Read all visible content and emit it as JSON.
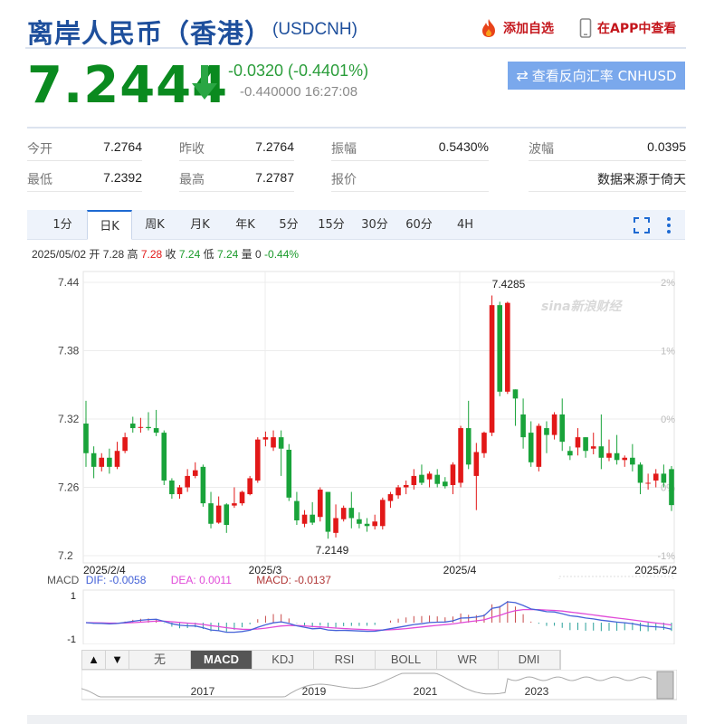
{
  "header": {
    "title": "离岸人民币（香港）",
    "code": "(USDCNH)",
    "add_watch": "添加自选",
    "app_view": "在APP中查看"
  },
  "quote": {
    "price": "7.2444",
    "change": "-0.0320 (-0.4401%)",
    "sub": "-0.440000 16:27:08",
    "reverse_btn": "查看反向汇率 CNHUSD",
    "direction": "down"
  },
  "stats": {
    "open_label": "今开",
    "open": "7.2764",
    "prev_label": "昨收",
    "prev": "7.2764",
    "amp_label": "振幅",
    "amp": "0.5430%",
    "wave_label": "波幅",
    "wave": "0.0395",
    "low_label": "最低",
    "low": "7.2392",
    "high_label": "最高",
    "high": "7.2787",
    "bid_label": "报价",
    "source": "数据来源于倚天"
  },
  "tabs": [
    "1分",
    "日K",
    "周K",
    "月K",
    "年K",
    "5分",
    "15分",
    "30分",
    "60分",
    "4H"
  ],
  "active_tab": "日K",
  "ohlc": {
    "date": "2025/05/02",
    "open_l": "开",
    "open": "7.28",
    "high_l": "高",
    "high": "7.28",
    "close_l": "收",
    "close": "7.24",
    "low_l": "低",
    "low": "7.24",
    "vol_l": "量",
    "vol": "0",
    "pct": "-0.44%"
  },
  "chart_data": [
    {
      "type": "candlestick",
      "y_ticks": [
        "7.44",
        "7.38",
        "7.32",
        "7.26",
        "7.2"
      ],
      "pct_ticks": [
        "2%",
        "1%",
        "0%",
        "0%",
        "-1%"
      ],
      "ylim": [
        7.2,
        7.44
      ],
      "x_labels": [
        "2025/2/4",
        "2025/3",
        "2025/4",
        "2025/5/2"
      ],
      "max_label": "7.4285",
      "min_label": "7.2149",
      "watermark": "sina新浪财经",
      "candles": [
        [
          7.316,
          7.29,
          7.336,
          7.278
        ],
        [
          7.29,
          7.278,
          7.296,
          7.268
        ],
        [
          7.278,
          7.286,
          7.29,
          7.274
        ],
        [
          7.286,
          7.278,
          7.294,
          7.272
        ],
        [
          7.278,
          7.292,
          7.3,
          7.276
        ],
        [
          7.292,
          7.304,
          7.308,
          7.29
        ],
        [
          7.316,
          7.312,
          7.322,
          7.308
        ],
        [
          7.313,
          7.313,
          7.321,
          7.308
        ],
        [
          7.313,
          7.312,
          7.326,
          7.31
        ],
        [
          7.312,
          7.308,
          7.328,
          7.305
        ],
        [
          7.308,
          7.266,
          7.31,
          7.262
        ],
        [
          7.266,
          7.254,
          7.268,
          7.25
        ],
        [
          7.254,
          7.26,
          7.262,
          7.25
        ],
        [
          7.26,
          7.27,
          7.276,
          7.256
        ],
        [
          7.27,
          7.275,
          7.282,
          7.268
        ],
        [
          7.278,
          7.246,
          7.28,
          7.243
        ],
        [
          7.246,
          7.228,
          7.256,
          7.224
        ],
        [
          7.229,
          7.244,
          7.252,
          7.228
        ],
        [
          7.245,
          7.227,
          7.246,
          7.22
        ],
        [
          7.244,
          7.246,
          7.26,
          7.242
        ],
        [
          7.246,
          7.256,
          7.257,
          7.244
        ],
        [
          7.254,
          7.268,
          7.27,
          7.253
        ],
        [
          7.266,
          7.302,
          7.304,
          7.264
        ],
        [
          7.302,
          7.304,
          7.309,
          7.296
        ],
        [
          7.295,
          7.304,
          7.31,
          7.292
        ],
        [
          7.304,
          7.294,
          7.31,
          7.27
        ],
        [
          7.293,
          7.251,
          7.298,
          7.248
        ],
        [
          7.248,
          7.231,
          7.256,
          7.227
        ],
        [
          7.228,
          7.236,
          7.24,
          7.225
        ],
        [
          7.236,
          7.229,
          7.247,
          7.227
        ],
        [
          7.234,
          7.258,
          7.26,
          7.23
        ],
        [
          7.256,
          7.221,
          7.256,
          7.2149
        ],
        [
          7.22,
          7.233,
          7.245,
          7.216
        ],
        [
          7.232,
          7.242,
          7.244,
          7.23
        ],
        [
          7.242,
          7.233,
          7.256,
          7.224
        ],
        [
          7.232,
          7.228,
          7.238,
          7.224
        ],
        [
          7.228,
          7.226,
          7.233,
          7.221
        ],
        [
          7.226,
          7.23,
          7.236,
          7.223
        ],
        [
          7.226,
          7.249,
          7.251,
          7.223
        ],
        [
          7.248,
          7.254,
          7.256,
          7.242
        ],
        [
          7.253,
          7.26,
          7.262,
          7.25
        ],
        [
          7.26,
          7.262,
          7.266,
          7.254
        ],
        [
          7.262,
          7.27,
          7.276,
          7.258
        ],
        [
          7.271,
          7.264,
          7.28,
          7.262
        ],
        [
          7.267,
          7.272,
          7.274,
          7.26
        ],
        [
          7.271,
          7.263,
          7.276,
          7.26
        ],
        [
          7.265,
          7.261,
          7.269,
          7.259
        ],
        [
          7.262,
          7.28,
          7.282,
          7.254
        ],
        [
          7.264,
          7.312,
          7.314,
          7.26
        ],
        [
          7.312,
          7.28,
          7.336,
          7.276
        ],
        [
          7.27,
          7.291,
          7.299,
          7.24
        ],
        [
          7.29,
          7.308,
          7.309,
          7.286
        ],
        [
          7.308,
          7.42,
          7.4285,
          7.305
        ],
        [
          7.42,
          7.344,
          7.423,
          7.34
        ],
        [
          7.344,
          7.422,
          7.423,
          7.342
        ],
        [
          7.346,
          7.338,
          7.346,
          7.314
        ],
        [
          7.324,
          7.304,
          7.338,
          7.294
        ],
        [
          7.308,
          7.282,
          7.318,
          7.278
        ],
        [
          7.278,
          7.314,
          7.316,
          7.274
        ],
        [
          7.312,
          7.306,
          7.318,
          7.29
        ],
        [
          7.306,
          7.324,
          7.326,
          7.302
        ],
        [
          7.324,
          7.3,
          7.338,
          7.292
        ],
        [
          7.292,
          7.288,
          7.296,
          7.284
        ],
        [
          7.295,
          7.304,
          7.312,
          7.288
        ],
        [
          7.304,
          7.292,
          7.304,
          7.286
        ],
        [
          7.294,
          7.296,
          7.308,
          7.289
        ],
        [
          7.296,
          7.286,
          7.324,
          7.276
        ],
        [
          7.286,
          7.29,
          7.302,
          7.283
        ],
        [
          7.29,
          7.284,
          7.306,
          7.28
        ],
        [
          7.284,
          7.286,
          7.288,
          7.278
        ],
        [
          7.286,
          7.28,
          7.298,
          7.274
        ],
        [
          7.28,
          7.264,
          7.282,
          7.254
        ],
        [
          7.264,
          7.264,
          7.272,
          7.258
        ],
        [
          7.266,
          7.272,
          7.276,
          7.26
        ],
        [
          7.272,
          7.264,
          7.28,
          7.26
        ],
        [
          7.276,
          7.2444,
          7.2787,
          7.2392
        ]
      ]
    },
    {
      "type": "macd",
      "title": "MACD",
      "dif_label": "DIF: -0.0058",
      "dea_label": "DEA: 0.0011",
      "macd_label": "MACD: -0.0137",
      "y_ticks": [
        "1",
        "-1"
      ]
    }
  ],
  "macd_colors": {
    "dif": "#4562d8",
    "dea": "#e04ad8",
    "macd": "#b23838"
  },
  "indicators": [
    "无",
    "MACD",
    "KDJ",
    "RSI",
    "BOLL",
    "WR",
    "DMI"
  ],
  "active_indicator": "MACD",
  "nav": {
    "up": "▲",
    "down": "▼",
    "years": [
      "2017",
      "2019",
      "2021",
      "2023"
    ]
  },
  "colors": {
    "up": "#e21818",
    "down": "#19a33a",
    "brand": "#1e4f9c"
  }
}
